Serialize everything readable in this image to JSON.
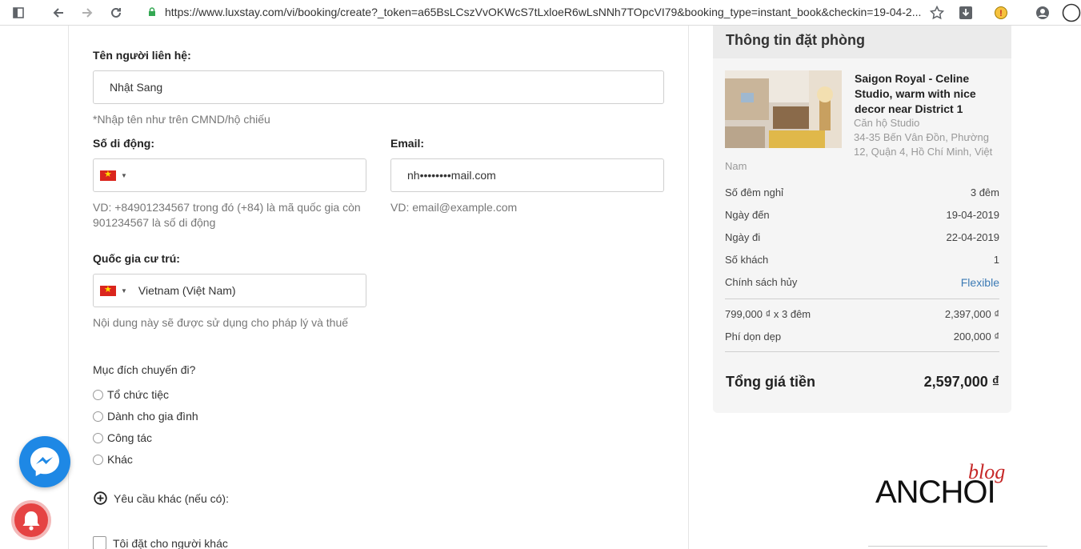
{
  "browser": {
    "url": "https://www.luxstay.com/vi/booking/create?_token=a65BsLCszVvOKWcS7tLxloeR6wLsNNh7TOpcVI79&booking_type=instant_book&checkin=19-04-2..."
  },
  "form": {
    "contact_label": "Tên người liên hệ:",
    "contact_value": "Nhật Sang",
    "contact_hint": "*Nhập tên như trên CMND/hộ chiếu",
    "mobile_label": "Số di động:",
    "mobile_hint_1": "VD: +84901234567 trong đó (+84) là mã quốc gia còn",
    "mobile_hint_2": "901234567 là số di động",
    "email_label": "Email:",
    "email_value": "nh••••••••mail.com",
    "email_hint": "VD: email@example.com",
    "country_label": "Quốc gia cư trú:",
    "country_value": "Vietnam (Việt Nam)",
    "country_hint": "Nội dung này sẽ được sử dụng cho pháp lý và thuế",
    "purpose_label": "Mục đích chuyến đi?",
    "purposes": [
      "Tổ chức tiệc",
      "Dành cho gia đình",
      "Công tác",
      "Khác"
    ],
    "other_request": "Yêu cầu khác (nếu có):",
    "book_for_other": "Tôi đặt cho người khác"
  },
  "booking": {
    "title": "Thông tin đặt phòng",
    "property_name": "Saigon Royal - Celine Studio, warm with nice decor near District 1",
    "property_type": "Căn hộ Studio",
    "address_1": "34-35 Bến Vân Đồn, Phường 12, Quận 4, Hồ Chí Minh, Việt",
    "address_2": "Nam",
    "rows": [
      {
        "label": "Số đêm nghỉ",
        "value": "3  đêm"
      },
      {
        "label": "Ngày đến",
        "value": "19-04-2019"
      },
      {
        "label": "Ngày đi",
        "value": "22-04-2019"
      },
      {
        "label": "Số khách",
        "value": "1"
      },
      {
        "label": "Chính sách hủy",
        "value": "Flexible"
      }
    ],
    "price_rows": [
      {
        "label": "799,000 ₫ x 3  đêm",
        "value": "2,397,000 ₫"
      },
      {
        "label": "Phí dọn dẹp",
        "value": "200,000 ₫"
      }
    ],
    "total_label": "Tổng giá tiền",
    "total_value": "2,597,000 ₫"
  },
  "logo": {
    "main": "ANCHOI",
    "script": "blog"
  }
}
